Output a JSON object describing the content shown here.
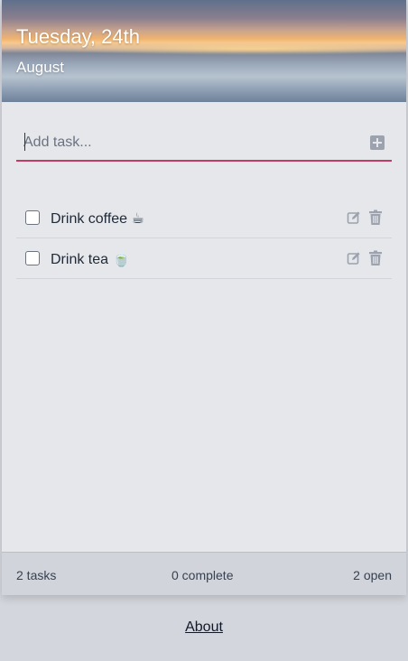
{
  "header": {
    "day": "Tuesday, 24th",
    "month": "August"
  },
  "add_task": {
    "placeholder": "Add task...",
    "add_icon": "plus-square-icon"
  },
  "tasks": [
    {
      "label": "Drink coffee ☕",
      "checked": false,
      "edit_icon": "edit-icon",
      "delete_icon": "trash-icon"
    },
    {
      "label": "Drink tea 🍵",
      "checked": false,
      "edit_icon": "edit-icon",
      "delete_icon": "trash-icon"
    }
  ],
  "footer": {
    "total": "2 tasks",
    "complete": "0 complete",
    "open": "2 open"
  },
  "links": {
    "about": "About"
  },
  "colors": {
    "accent": "#c23b63",
    "background": "#e5e7eb",
    "icon": "#9ca3af"
  }
}
